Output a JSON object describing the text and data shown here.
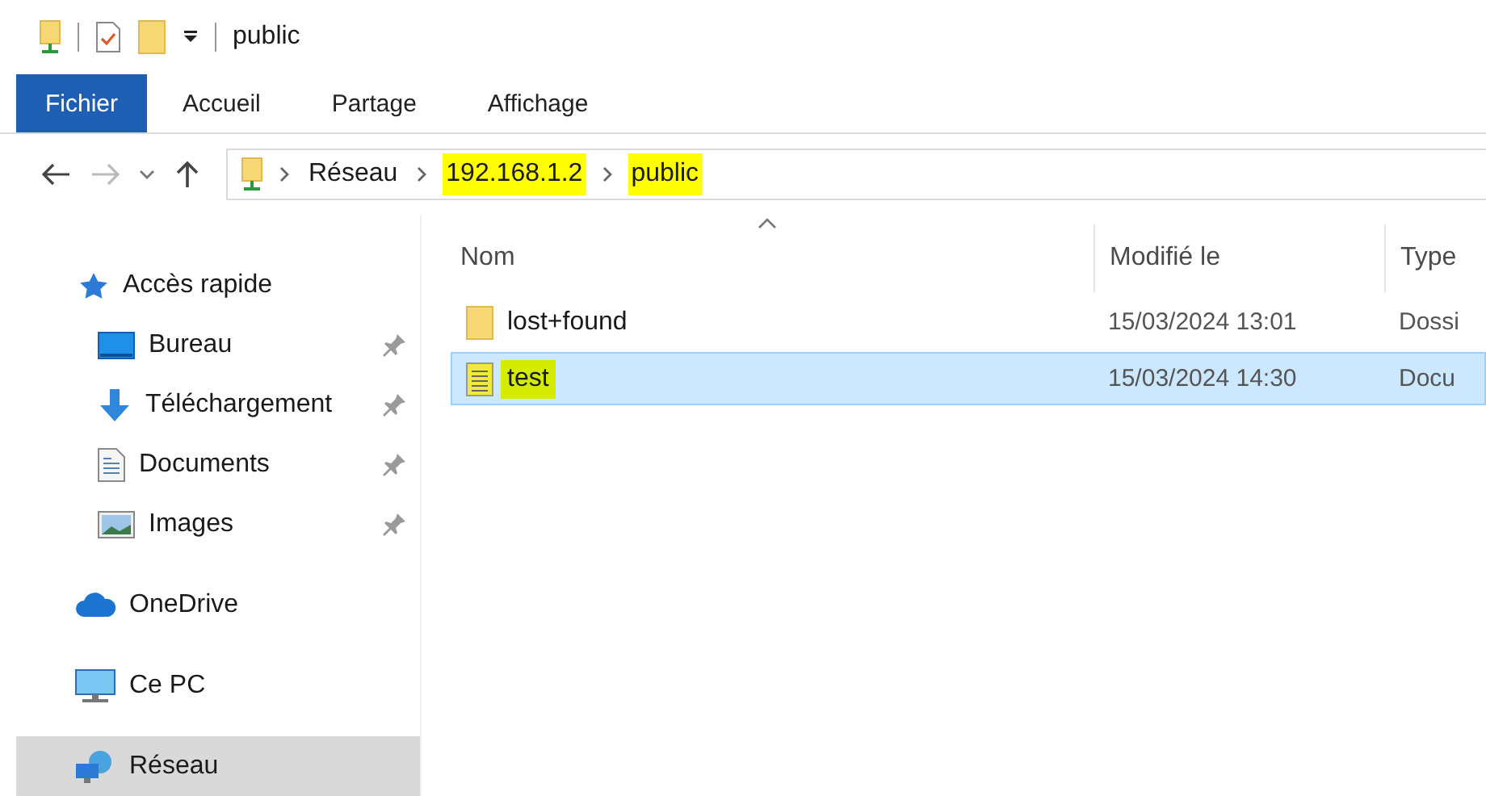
{
  "title_bar": {
    "title": "public"
  },
  "ribbon_tabs": [
    {
      "label": "Fichier",
      "selected": true
    },
    {
      "label": "Accueil",
      "selected": false
    },
    {
      "label": "Partage",
      "selected": false
    },
    {
      "label": "Affichage",
      "selected": false
    }
  ],
  "address_bar": {
    "crumbs": [
      {
        "label": "Réseau",
        "highlighted": false
      },
      {
        "label": "192.168.1.2",
        "highlighted": true
      },
      {
        "label": "public",
        "highlighted": true
      }
    ]
  },
  "sidebar": {
    "items": [
      {
        "label": "Accès rapide",
        "kind": "star",
        "selected": false,
        "children": [
          {
            "label": "Bureau",
            "kind": "desktop",
            "pinned": true,
            "selected": false
          },
          {
            "label": "Téléchargement",
            "kind": "download",
            "pinned": true,
            "selected": false
          },
          {
            "label": "Documents",
            "kind": "documents",
            "pinned": true,
            "selected": false
          },
          {
            "label": "Images",
            "kind": "images",
            "pinned": true,
            "selected": false
          }
        ]
      },
      {
        "label": "OneDrive",
        "kind": "cloud",
        "selected": false
      },
      {
        "label": "Ce PC",
        "kind": "pc",
        "selected": false
      },
      {
        "label": "Réseau",
        "kind": "network",
        "selected": true
      }
    ]
  },
  "table": {
    "columns": [
      {
        "label": "Nom",
        "sorted": true
      },
      {
        "label": "Modifié le",
        "sorted": false
      },
      {
        "label": "Type",
        "sorted": false
      }
    ],
    "rows": [
      {
        "name": "lost+found",
        "kind": "folder",
        "modified": "15/03/2024 13:01",
        "type": "Dossi",
        "selected": false,
        "highlighted": false
      },
      {
        "name": "test",
        "kind": "document",
        "modified": "15/03/2024 14:30",
        "type": "Docu",
        "selected": true,
        "highlighted": true
      }
    ]
  }
}
